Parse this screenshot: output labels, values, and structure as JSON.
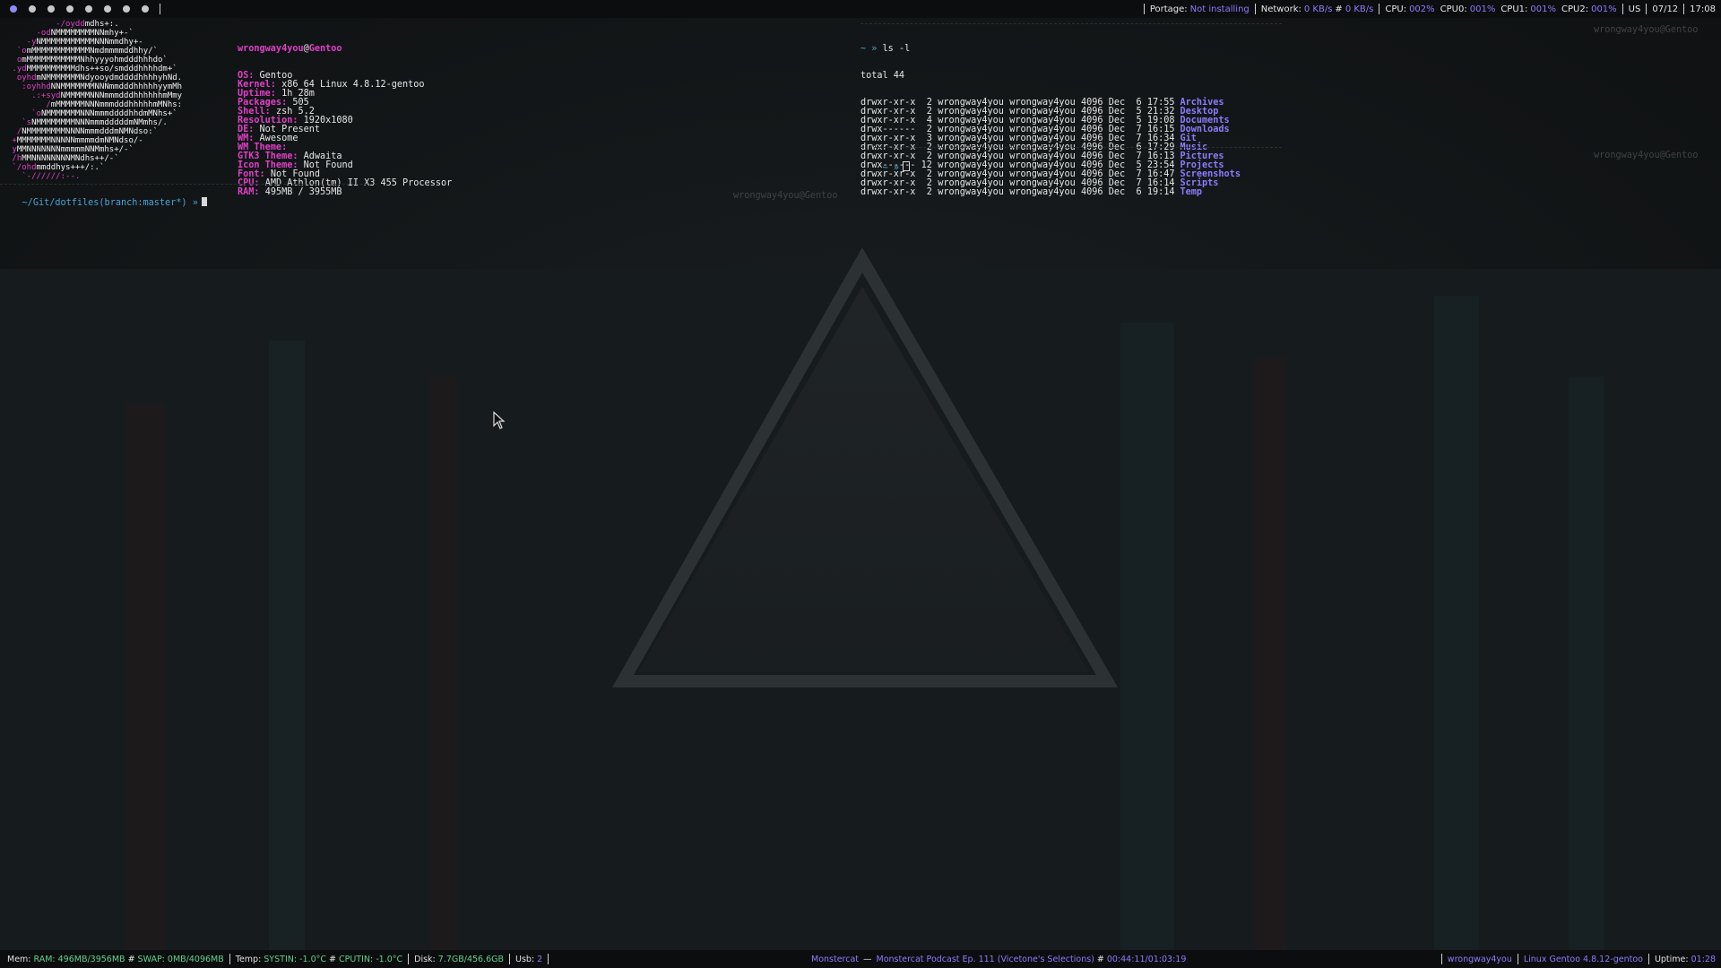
{
  "topbar": {
    "tags": [
      {
        "glyph": "●",
        "active": true
      },
      {
        "glyph": "●",
        "active": false
      },
      {
        "glyph": "●",
        "active": false
      },
      {
        "glyph": "●",
        "active": false
      },
      {
        "glyph": "●",
        "active": false
      },
      {
        "glyph": "●",
        "active": false
      },
      {
        "glyph": "●",
        "active": false
      },
      {
        "glyph": "●",
        "active": false
      }
    ],
    "portage_label": "Portage:",
    "portage_value": "Not installing",
    "network_label": "Network:",
    "net_down": "0 KB/s",
    "net_up": "0 KB/s",
    "cpu_label": "CPU:",
    "cpu_value": "002%",
    "cpu0_label": "CPU0:",
    "cpu0_value": "001%",
    "cpu1_label": "CPU1:",
    "cpu1_value": "001%",
    "cpu2_label": "CPU2:",
    "cpu2_value": "001%",
    "layout": "US",
    "date": "07/12",
    "time": "17:08"
  },
  "left_terminal": {
    "watermark": "wrongway4you@Gentoo",
    "user": "wrongway4you",
    "at": "@",
    "host": "Gentoo",
    "info": [
      {
        "key": "OS:",
        "value": "Gentoo"
      },
      {
        "key": "Kernel:",
        "value": "x86_64 Linux 4.8.12-gentoo"
      },
      {
        "key": "Uptime:",
        "value": "1h 28m"
      },
      {
        "key": "Packages:",
        "value": "505"
      },
      {
        "key": "Shell:",
        "value": "zsh 5.2"
      },
      {
        "key": "Resolution:",
        "value": "1920x1080"
      },
      {
        "key": "DE:",
        "value": "Not Present"
      },
      {
        "key": "WM:",
        "value": "Awesome"
      },
      {
        "key": "WM Theme:",
        "value": ""
      },
      {
        "key": "GTK3 Theme:",
        "value": "Adwaita"
      },
      {
        "key": "Icon Theme:",
        "value": "Not Found"
      },
      {
        "key": "Font:",
        "value": "Not Found"
      },
      {
        "key": "CPU:",
        "value": "AMD Athlon(tm) II X3 455 Processor"
      },
      {
        "key": "RAM:",
        "value": "495MB / 3955MB"
      }
    ],
    "logo_lines": [
      "          -/oyddmdhs+:.",
      "      -odNMMMMMMMMNNmhy+-`",
      "    -yNMMMMMMMMMMMNNNmmdhy+-",
      "  `omMMMMMMMMMMMMNmdmmmmddhhy/`",
      "  omMMMMMMMMMMMNhhyyyohmdddhhhdo`",
      " .ydMMMMMMMMMMdhs++so/smdddhhhhdm+`",
      "  oyhdmNMMMMMMMNdyooydmddddhhhhyhNd.",
      "   :oyhhdNNMMMMMMMNNNmmdddhhhhhyymMh",
      "     .:+sydNMMMMMNNNmmmdddhhhhhhmMmy",
      "        /mMMMMMMNNNmmmdddhhhhhmMNhs:",
      "     `oNMMMMMMMNNNmmmddddhhdmMNhs+`",
      "   `sNMMMMMMMMNNNmmmdddddmNMmhs/.",
      "  /NMMMMMMMMNNNNmmmdddmNMNdso:`",
      " +MMMMMMMNNNNNmmmmdmNMNdso/-",
      " yMMNNNNNNNmmmmmNNMmhs+/-`",
      " /hMMNNNNNNNNMNdhs++/-`",
      " `/ohdmmddhys+++/:.`",
      "   `-//////:--."
    ],
    "prompt_dir": "~/Git/dotfiles",
    "prompt_branch": "(branch:master*)",
    "prompt_arrow": "»"
  },
  "right_terminal": {
    "watermark_top": "wrongway4you@Gentoo",
    "watermark_bottom": "wrongway4you@Gentoo",
    "prompt_symbol": "~ »",
    "command": "ls -l",
    "total": "total 44",
    "rows": [
      {
        "perm": "drwxr-xr-x",
        "links": "2",
        "owner": "wrongway4you",
        "group": "wrongway4you",
        "size": "4096",
        "month": "Dec",
        "day": "6",
        "time": "17:55",
        "name": "Archives"
      },
      {
        "perm": "drwxr-xr-x",
        "links": "2",
        "owner": "wrongway4you",
        "group": "wrongway4you",
        "size": "4096",
        "month": "Dec",
        "day": "5",
        "time": "21:32",
        "name": "Desktop"
      },
      {
        "perm": "drwxr-xr-x",
        "links": "4",
        "owner": "wrongway4you",
        "group": "wrongway4you",
        "size": "4096",
        "month": "Dec",
        "day": "5",
        "time": "19:08",
        "name": "Documents"
      },
      {
        "perm": "drwx------",
        "links": "2",
        "owner": "wrongway4you",
        "group": "wrongway4you",
        "size": "4096",
        "month": "Dec",
        "day": "7",
        "time": "16:15",
        "name": "Downloads"
      },
      {
        "perm": "drwxr-xr-x",
        "links": "3",
        "owner": "wrongway4you",
        "group": "wrongway4you",
        "size": "4096",
        "month": "Dec",
        "day": "7",
        "time": "16:34",
        "name": "Git"
      },
      {
        "perm": "drwxr-xr-x",
        "links": "2",
        "owner": "wrongway4you",
        "group": "wrongway4you",
        "size": "4096",
        "month": "Dec",
        "day": "6",
        "time": "17:29",
        "name": "Music"
      },
      {
        "perm": "drwxr-xr-x",
        "links": "2",
        "owner": "wrongway4you",
        "group": "wrongway4you",
        "size": "4096",
        "month": "Dec",
        "day": "7",
        "time": "16:13",
        "name": "Pictures"
      },
      {
        "perm": "drwx------",
        "links": "12",
        "owner": "wrongway4you",
        "group": "wrongway4you",
        "size": "4096",
        "month": "Dec",
        "day": "5",
        "time": "23:54",
        "name": "Projects"
      },
      {
        "perm": "drwxr-xr-x",
        "links": "2",
        "owner": "wrongway4you",
        "group": "wrongway4you",
        "size": "4096",
        "month": "Dec",
        "day": "7",
        "time": "16:47",
        "name": "Screenshots"
      },
      {
        "perm": "drwxr-xr-x",
        "links": "2",
        "owner": "wrongway4you",
        "group": "wrongway4you",
        "size": "4096",
        "month": "Dec",
        "day": "7",
        "time": "16:14",
        "name": "Scripts"
      },
      {
        "perm": "drwxr-xr-x",
        "links": "2",
        "owner": "wrongway4you",
        "group": "wrongway4you",
        "size": "4096",
        "month": "Dec",
        "day": "6",
        "time": "19:14",
        "name": "Temp"
      }
    ],
    "prompt2": "~ »"
  },
  "bottombar": {
    "mem_label": "Mem:",
    "ram": "RAM: 496MB/3956MB",
    "swap": "SWAP: 0MB/4096MB",
    "temp_label": "Temp:",
    "systin": "SYSTIN: -1.0°C",
    "cputin": "CPUTIN: -1.0°C",
    "disk_label": "Disk:",
    "disk_value": "7.7GB/456.6GB",
    "usb_label": "Usb:",
    "usb_value": "2",
    "artist": "Monstercat",
    "dash": "—",
    "track": "Monstercat Podcast Ep. 111 (Vicetone's Selections)",
    "progress": "00:44:11/01:03:19",
    "user": "wrongway4you",
    "kernel": "Linux Gentoo 4.8.12-gentoo",
    "uptime_label": "Uptime:",
    "uptime_value": "01:28"
  },
  "colors": {
    "accent_purple": "#8c7cff",
    "accent_pink": "#e040c8",
    "accent_blue": "#4aa3d9",
    "accent_green": "#5fd38d"
  }
}
